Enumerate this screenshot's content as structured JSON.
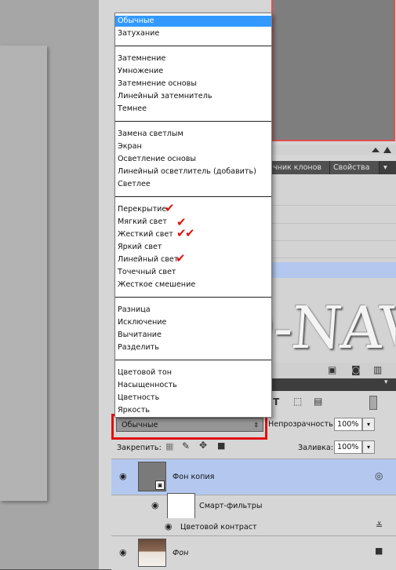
{
  "blend_menu": {
    "groups": [
      [
        "Обычные",
        "Затухание"
      ],
      [
        "Затемнение",
        "Умножение",
        "Затемнение основы",
        "Линейный затемнитель",
        "Темнее"
      ],
      [
        "Замена светлым",
        "Экран",
        "Осветление основы",
        "Линейный осветлитель (добавить)",
        "Светлее"
      ],
      [
        "Перекрытие",
        "Мягкий свет",
        "Жесткий свет",
        "Яркий свет",
        "Линейный свет",
        "Точечный свет",
        "Жесткое смешение"
      ],
      [
        "Разница",
        "Исключение",
        "Вычитание",
        "Разделить"
      ],
      [
        "Цветовой тон",
        "Насыщенность",
        "Цветность",
        "Яркость"
      ]
    ],
    "selected": "Обычные",
    "check_mark": "✔"
  },
  "panels": {
    "tabs": [
      "чник клонов",
      "Свойства"
    ],
    "watermark": "D-NAVI"
  },
  "layers_panel": {
    "blend_mode_value": "Обычные",
    "opacity_label": "Непрозрачность:",
    "opacity_value": "100%",
    "lock_label": "Закрепить:",
    "fill_label": "Заливка:",
    "fill_value": "100%",
    "layers": {
      "fon_copy": "Фон копия",
      "smart_filters": "Смарт-фильтры",
      "color_contrast": "Цветовой контраст",
      "fon": "Фон"
    }
  },
  "colors": {
    "menu_highlight": "#3399ff",
    "annotation_red": "#e01010",
    "layer_selected": "#b4c8ef"
  }
}
